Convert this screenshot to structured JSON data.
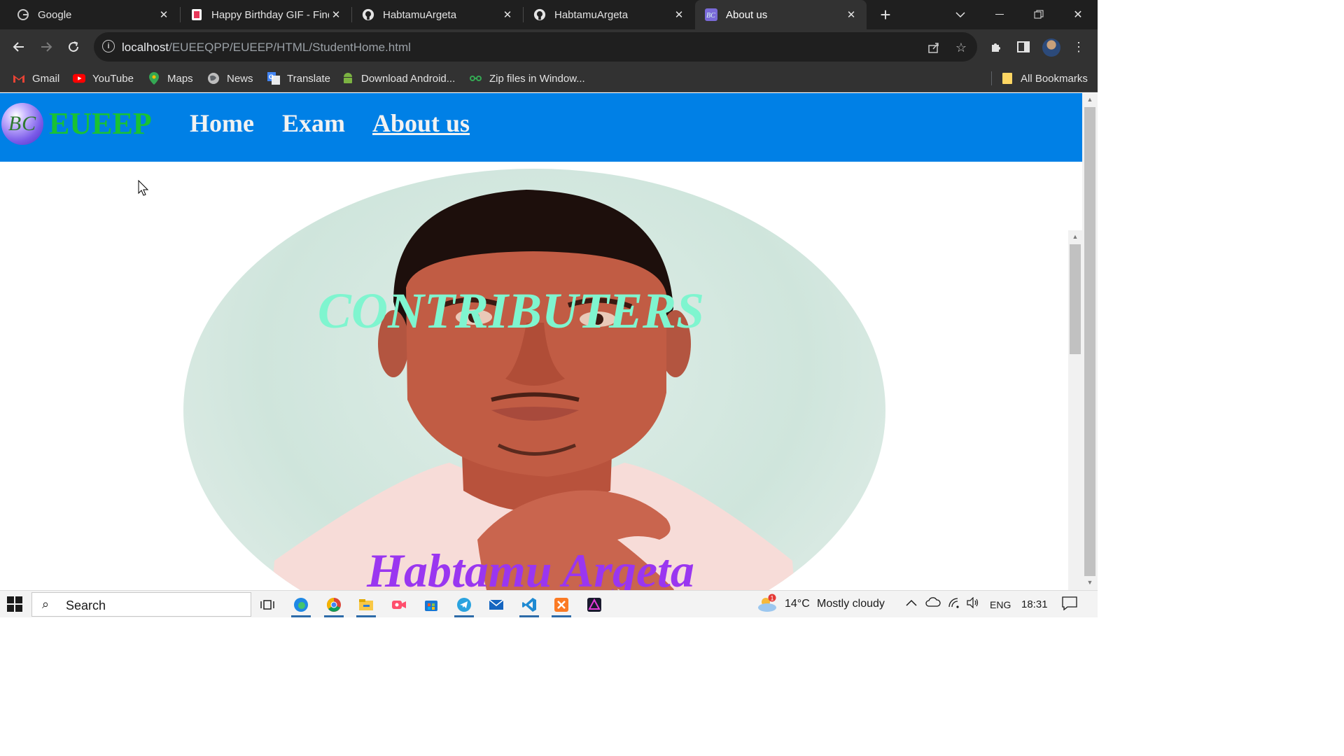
{
  "tabs": [
    {
      "title": "Google",
      "icon": "google-icon"
    },
    {
      "title": "Happy Birthday GIF - Find",
      "icon": "tenor-icon"
    },
    {
      "title": "HabtamuArgeta",
      "icon": "github-icon"
    },
    {
      "title": "HabtamuArgeta",
      "icon": "github-icon"
    },
    {
      "title": "About us",
      "icon": "bc-favicon",
      "active": true
    }
  ],
  "address": {
    "host": "localhost",
    "path": "/EUEEQPP/EUEEP/HTML/StudentHome.html"
  },
  "bookmarks": [
    {
      "label": "Gmail",
      "icon": "gmail-icon"
    },
    {
      "label": "YouTube",
      "icon": "youtube-icon"
    },
    {
      "label": "Maps",
      "icon": "maps-icon"
    },
    {
      "label": "News",
      "icon": "news-icon"
    },
    {
      "label": "Translate",
      "icon": "translate-icon"
    },
    {
      "label": "Download Android...",
      "icon": "android-icon"
    },
    {
      "label": "Zip files in Window...",
      "icon": "zip-icon"
    }
  ],
  "all_bookmarks": "All Bookmarks",
  "site": {
    "logo_initials": "BC",
    "logo_text": "EUEEP",
    "nav": [
      {
        "label": "Home"
      },
      {
        "label": "Exam"
      },
      {
        "label": "About us",
        "current": true
      }
    ],
    "heading": "CONTRIBUTERS",
    "contributor_name": "Habtamu Argeta",
    "colors": {
      "nav_bg": "#0080e6",
      "logo_text": "#19c233",
      "heading": "#7ff5cf",
      "name": "#9a36f0"
    }
  },
  "taskbar": {
    "search_label": "Search",
    "weather_temp": "14°C",
    "weather_desc": "Mostly cloudy",
    "weather_badge": "1",
    "language": "ENG",
    "time": "18:31"
  }
}
